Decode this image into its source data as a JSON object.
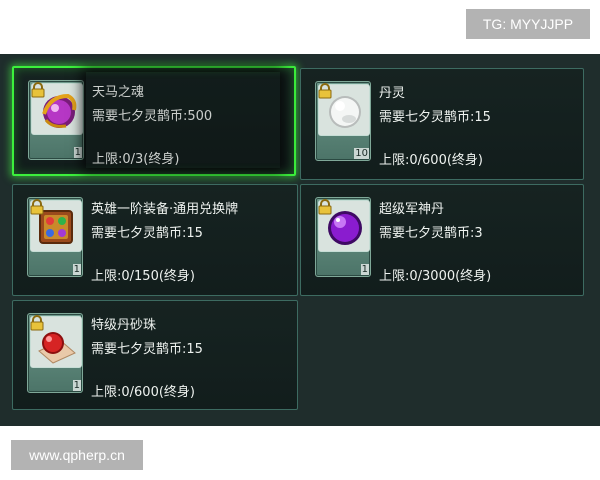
{
  "watermarks": {
    "tg": "TG: MYYJJPP",
    "site": "www.qpherp.cn"
  },
  "shop": {
    "items": [
      {
        "name": "天马之魂",
        "cost": "需要七夕灵鹊币:500",
        "limit": "上限:0/3(终身)",
        "count": "1",
        "icon": "purple-pegasus-soul-icon",
        "selected": true
      },
      {
        "name": "丹灵",
        "cost": "需要七夕灵鹊币:15",
        "limit": "上限:0/600(终身)",
        "count": "10",
        "icon": "white-pearl-icon",
        "selected": false
      },
      {
        "name": "英雄一阶装备·通用兑换牌",
        "cost": "需要七夕灵鹊币:15",
        "limit": "上限:0/150(终身)",
        "count": "1",
        "icon": "exchange-token-icon",
        "selected": false
      },
      {
        "name": "超级军神丹",
        "cost": "需要七夕灵鹊币:3",
        "limit": "上限:0/3000(终身)",
        "count": "1",
        "icon": "purple-orb-icon",
        "selected": false
      },
      {
        "name": "特级丹砂珠",
        "cost": "需要七夕灵鹊币:15",
        "limit": "上限:0/600(终身)",
        "count": "1",
        "icon": "red-cinnabar-pearl-icon",
        "selected": false
      }
    ]
  },
  "colors": {
    "panel_bg": "#1f2d2c",
    "card_border": "#3d6b61",
    "selected_glow": "#3cf03c",
    "text": "#eef2ef"
  }
}
